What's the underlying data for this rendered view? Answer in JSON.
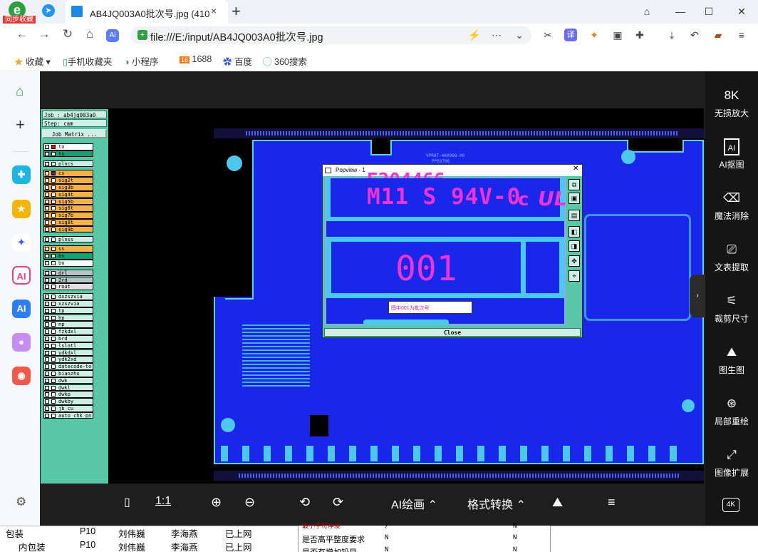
{
  "browser": {
    "sync_badge": "同步收藏",
    "tab_title": "AB4JQ003A0批次号.jpg (410",
    "tab_close": "×",
    "new_tab": "+",
    "address": "file:///E:/input/AB4JQ003A0批次号.jpg",
    "ai_badge": "Ai",
    "translate_badge": "译",
    "window_buttons": [
      "—",
      "☐",
      "✕"
    ],
    "bookmarks": [
      "收藏",
      "手机收藏夹",
      "小程序",
      "1688",
      "百度",
      "360搜索"
    ]
  },
  "left_toolbar": {
    "items": [
      "home",
      "add",
      "apps",
      "star",
      "network",
      "ai-circle",
      "ai",
      "chat",
      "game"
    ]
  },
  "cam": {
    "job_label": "Job : ab4jq003a0",
    "step_label": "Step: cam",
    "matrix_button": "Job Matrix ...",
    "layers": [
      {
        "name": "to",
        "color": "#ffffff"
      },
      {
        "name": "ts",
        "color": "#14a070"
      },
      {
        "name": "plncs",
        "color": "#cfeee4"
      },
      {
        "name": "cs",
        "color": "#f5b04a"
      },
      {
        "name": "sig2t",
        "color": "#f5b04a"
      },
      {
        "name": "sig3b",
        "color": "#f5b04a"
      },
      {
        "name": "sig4t",
        "color": "#f5b04a"
      },
      {
        "name": "sig5b",
        "color": "#f5b04a"
      },
      {
        "name": "sig6t",
        "color": "#f5b04a"
      },
      {
        "name": "sig7b",
        "color": "#f5b04a"
      },
      {
        "name": "sig8t",
        "color": "#f5b04a"
      },
      {
        "name": "sig9b",
        "color": "#f5b04a"
      },
      {
        "name": "plnss",
        "color": "#cfeee4"
      },
      {
        "name": "ss",
        "color": "#f5b04a"
      },
      {
        "name": "bs",
        "color": "#14a070"
      },
      {
        "name": "bo",
        "color": "#ffffff"
      },
      {
        "name": "drl",
        "color": "#b9c4c4"
      },
      {
        "name": "2rd",
        "color": "#b9c4c4"
      },
      {
        "name": "rout",
        "color": "#e0e0e0"
      },
      {
        "name": "dxzszvia",
        "color": "#cfeee4"
      },
      {
        "name": "xzszvia",
        "color": "#cfeee4"
      },
      {
        "name": "tp",
        "color": "#cfeee4"
      },
      {
        "name": "bp",
        "color": "#cfeee4"
      },
      {
        "name": "np",
        "color": "#cfeee4"
      },
      {
        "name": "fzkdxl",
        "color": "#cfeee4"
      },
      {
        "name": "brd",
        "color": "#cfeee4"
      },
      {
        "name": "lslotl",
        "color": "#cfeee4"
      },
      {
        "name": "ydkdxl",
        "color": "#cfeee4"
      },
      {
        "name": "ydk2xd",
        "color": "#cfeee4"
      },
      {
        "name": "datecode-to",
        "color": "#cfeee4"
      },
      {
        "name": "biaozhu",
        "color": "#cfeee4"
      },
      {
        "name": "dwk",
        "color": "#cfeee4"
      },
      {
        "name": "dwkl",
        "color": "#cfeee4"
      },
      {
        "name": "dwkp",
        "color": "#cfeee4"
      },
      {
        "name": "dwkby",
        "color": "#cfeee4"
      },
      {
        "name": "jb_cu",
        "color": "#cfeee4"
      },
      {
        "name": "auto_chk_pn",
        "color": "#cfeee4"
      }
    ],
    "board_top_text": "VPRAT-4A0008-00",
    "board_top_text2": "PP03706",
    "popview": {
      "title": "Popview - 1",
      "close_x": "✕",
      "marking_line1": "E204466",
      "marking_line2": "M11 S 94V-0",
      "marking_c": "c",
      "marking_ul": "UL",
      "batch_number": "001",
      "note": "图中001为批次号",
      "close_button": "Close",
      "tools": [
        "⧉",
        "▣",
        "▤",
        "◧",
        "◨",
        "✥",
        "⌖"
      ]
    }
  },
  "right_tools": [
    {
      "icon": "8K",
      "label": "无损放大"
    },
    {
      "icon": "AI",
      "label": "AI抠图"
    },
    {
      "icon": "⌫",
      "label": "魔法消除"
    },
    {
      "icon": "⎚",
      "label": "文表提取"
    },
    {
      "icon": "⚟",
      "label": "裁剪尺寸"
    },
    {
      "icon": "⛰",
      "label": "图生图"
    },
    {
      "icon": "⊛",
      "label": "局部重绘"
    },
    {
      "icon": "⤢",
      "label": "图像扩展"
    },
    {
      "icon": "4K",
      "label": ""
    }
  ],
  "bottom_tools": {
    "one_to_one": "1:1",
    "ai_draw": "AI绘画",
    "format_convert": "格式转换"
  },
  "sheet": {
    "rows": [
      [
        "包装",
        "P10",
        "刘伟巍",
        "李海燕",
        "已上网"
      ],
      [
        "内包装",
        "P10",
        "刘伟巍",
        "李海燕",
        "已上网"
      ]
    ],
    "side_rows": [
      [
        "最小字符厚度",
        "/",
        "N"
      ],
      [
        "是否高平整度要求",
        "N",
        "N"
      ],
      [
        "是否有增加铅目",
        "N",
        "N"
      ]
    ]
  }
}
